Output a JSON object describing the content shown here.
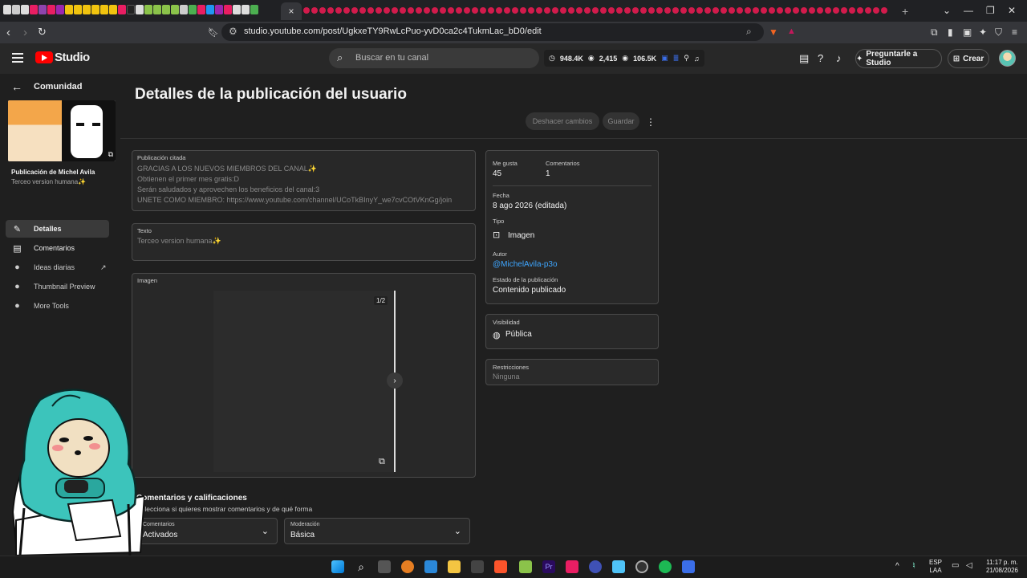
{
  "browser": {
    "active_tab_close": "×",
    "new_tab": "+",
    "url": "studio.youtube.com/post/UgkxeTY9RwLcPuo-yvD0ca2c4TukmLac_bD0/edit"
  },
  "header": {
    "logo": "Studio",
    "search_placeholder": "Buscar en tu canal",
    "stats": [
      "948.4K",
      "2,415",
      "106.5K"
    ],
    "ask_label": "Preguntarle a Studio",
    "create_label": "Crear"
  },
  "sidebar": {
    "back_label": "Comunidad",
    "post_title": "Publicación de Michel Avila",
    "post_subtitle": "Terceo version humana✨",
    "items": [
      {
        "label": "Detalles",
        "icon": "pencil-icon",
        "glyph": "✎"
      },
      {
        "label": "Comentarios",
        "icon": "comment-icon",
        "glyph": "▤"
      },
      {
        "label": "Ideas diarias",
        "icon": "app-icon",
        "glyph": "●"
      },
      {
        "label": "Thumbnail Preview",
        "icon": "app-icon",
        "glyph": "●"
      },
      {
        "label": "More Tools",
        "icon": "app-icon",
        "glyph": "●"
      }
    ]
  },
  "main": {
    "title": "Detalles de la publicación del usuario",
    "undo_label": "Deshacer cambios",
    "save_label": "Guardar",
    "quoted": {
      "label": "Publicación citada",
      "lines": [
        "GRACIAS A LOS NUEVOS MIEMBROS DEL CANAL✨",
        "Obtienen el primer mes gratis:D",
        "Serán saludados y aprovechen los beneficios del canal:3",
        "UNETE COMO MIEMBRO: https://www.youtube.com/channel/UCoTkBInyY_we7cvCOtVKnGg/join"
      ]
    },
    "text": {
      "label": "Texto",
      "value": "Terceo version humana✨"
    },
    "image": {
      "label": "Imagen",
      "counter": "1/2"
    },
    "comments_section": {
      "title": "Comentarios y calificaciones",
      "subtitle": "Selecciona si quieres mostrar comentarios y de qué forma",
      "comments_label": "Comentarios",
      "comments_value": "Activados",
      "moderation_label": "Moderación",
      "moderation_value": "Básica"
    }
  },
  "info": {
    "likes_label": "Me gusta",
    "likes": "45",
    "comments_label": "Comentarios",
    "comments": "1",
    "date_label": "Fecha",
    "date": "8 ago 2026 (editada)",
    "type_label": "Tipo",
    "type": "Imagen",
    "author_label": "Autor",
    "author": "@MichelAvila-p3o",
    "status_label": "Estado de la publicación",
    "status": "Contenido publicado",
    "visibility_label": "Visibilidad",
    "visibility": "Pública",
    "restrictions_label": "Restricciones",
    "restrictions": "Ninguna"
  },
  "taskbar": {
    "lang_top": "ESP",
    "lang_bottom": "LAA",
    "time": "11:17 p. m.",
    "date": "21/08/2026"
  },
  "colors": {
    "accent_link": "#3ea6ff",
    "brand_red": "#ff0000",
    "background": "#1f1f1f"
  }
}
